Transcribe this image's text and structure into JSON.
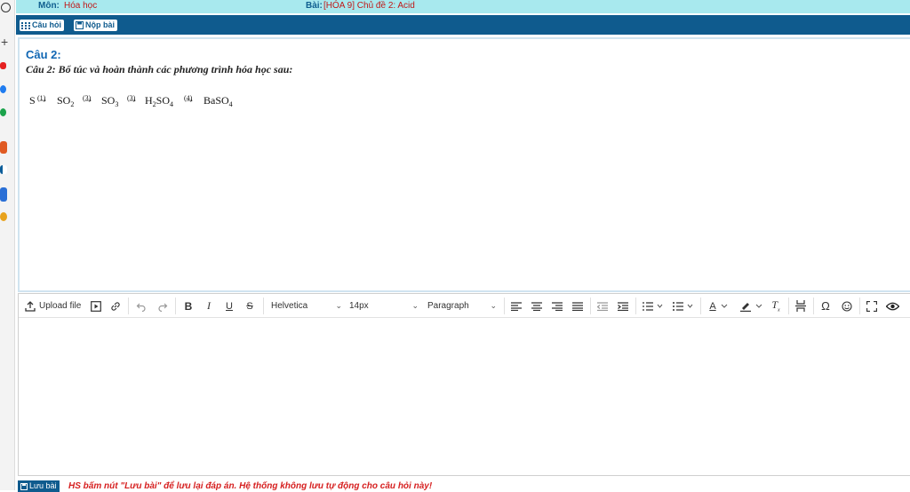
{
  "topbar": {
    "subject_label": "Môn:",
    "subject_value": "Hóa học",
    "lesson_label": "Bài:",
    "lesson_value": "[HÓA 9] Chủ đề 2: Acid"
  },
  "band": {
    "questions_label": "Câu hỏi",
    "submit_label": "Nộp bài"
  },
  "question": {
    "title": "Câu 2:",
    "text": "Câu 2: Bổ túc và hoàn thành các phương trình hóa học sau:",
    "chain": {
      "s": "S",
      "so2": "SO",
      "so2_sub": "2",
      "so3": "SO",
      "so3_sub": "3",
      "h2": "H",
      "h2_sub": "2",
      "so4": "SO",
      "so4_sub": "4",
      "baso4": "BaSO",
      "baso4_sub": "4",
      "step1": "(1)",
      "step2": "(3)",
      "step3": "(3)",
      "step4": "(4)",
      "arrow": "→"
    }
  },
  "editor": {
    "upload_label": "Upload file",
    "font_family": "Helvetica",
    "font_size": "14px",
    "block_format": "Paragraph",
    "bold": "B",
    "italic": "I",
    "underline": "U",
    "strike": "S",
    "omega": "Ω",
    "text_color": "A"
  },
  "footer": {
    "save_label": "Lưu bài",
    "note": "HS bấm nút \"Lưu bài\" để lưu lại đáp án. Hệ thống không lưu tự động cho câu hỏi này!"
  },
  "colors": {
    "topbar_bg": "#a8e9ee",
    "band_bg": "#0f5b8e",
    "title_blue": "#1066b3",
    "note_red": "#d62020"
  }
}
